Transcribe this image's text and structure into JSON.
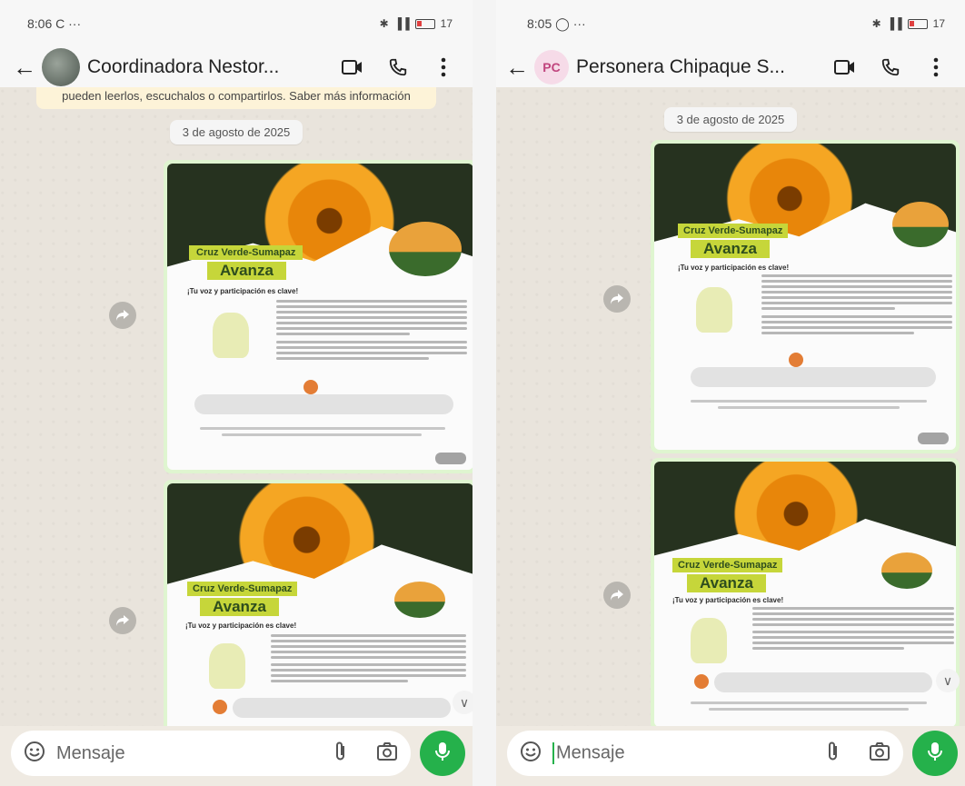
{
  "left": {
    "status": {
      "time": "8:06",
      "extra": "C ···",
      "battery": "17"
    },
    "contact_name": "Coordinadora Nestor...",
    "system_message": "pueden leerlos, escuchalos o compartirlos. Saber más información",
    "date_chip": "3 de agosto de 2025",
    "poster": {
      "badge": "Cruz Verde-Sumapaz",
      "heading": "Avanza",
      "subtitle": "¡Tu voz y participación es clave!"
    },
    "composer_placeholder": "Mensaje"
  },
  "right": {
    "status": {
      "time": "8:05",
      "extra": "···",
      "battery": "17"
    },
    "avatar_initials": "PC",
    "contact_name": "Personera Chipaque S...",
    "date_chip": "3 de agosto de 2025",
    "poster": {
      "badge": "Cruz Verde-Sumapaz",
      "heading": "Avanza",
      "subtitle": "¡Tu voz y participación es clave!"
    },
    "composer_placeholder": "Mensaje"
  },
  "accent": "#25b14b",
  "icons": [
    "back-arrow-icon",
    "video-call-icon",
    "phone-icon",
    "menu-dots-icon",
    "forward-icon",
    "emoji-sticker-icon",
    "attach-icon",
    "camera-icon",
    "mic-icon",
    "chevron-down-icon"
  ]
}
